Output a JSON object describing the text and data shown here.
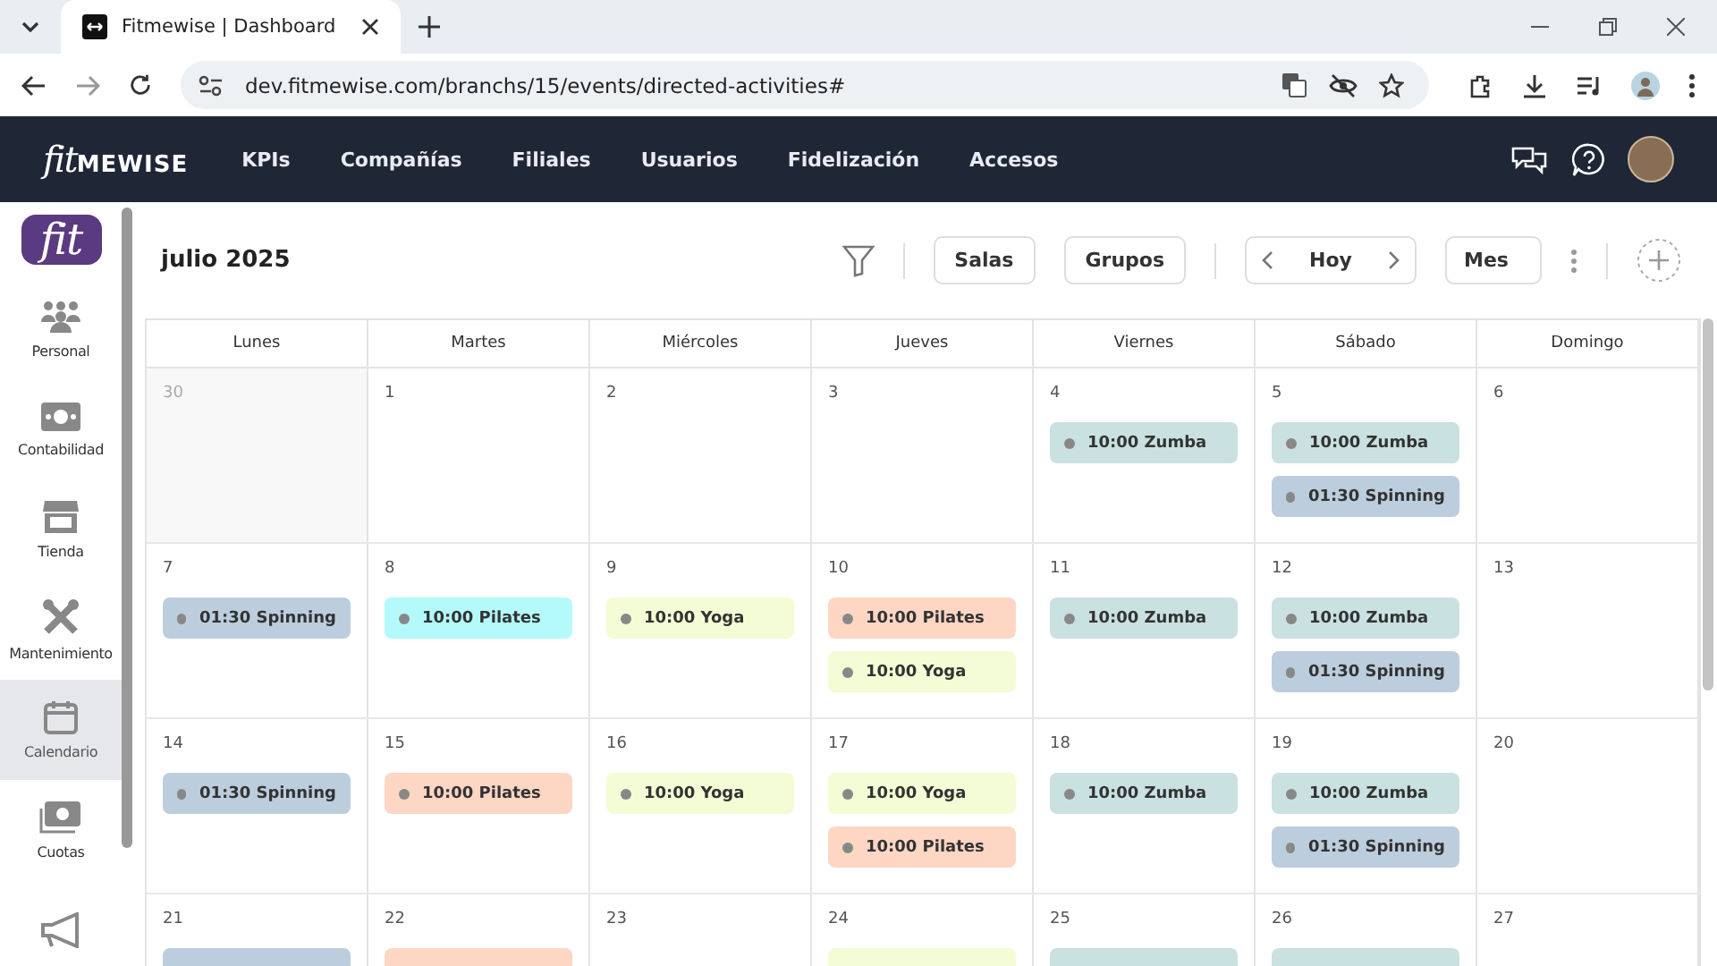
{
  "browser": {
    "tab_title": "Fitmewise | Dashboard",
    "url": "dev.fitmewise.com/branchs/15/events/directed-activities#"
  },
  "nav": {
    "logo": {
      "script": "fit",
      "text": "MEWISE"
    },
    "items": [
      {
        "label": "KPIs"
      },
      {
        "label": "Compañías"
      },
      {
        "label": "Filiales"
      },
      {
        "label": "Usuarios"
      },
      {
        "label": "Fidelización"
      },
      {
        "label": "Accesos"
      }
    ]
  },
  "sidebar": {
    "logo": "fit",
    "items": [
      {
        "label": "Personal",
        "selected": false
      },
      {
        "label": "Contabilidad",
        "selected": false
      },
      {
        "label": "Tienda",
        "selected": false
      },
      {
        "label": "Mantenimiento",
        "selected": false
      },
      {
        "label": "Calendario",
        "selected": true
      },
      {
        "label": "Cuotas",
        "selected": false
      },
      {
        "selected": false
      }
    ]
  },
  "toolbar": {
    "title": "julio 2025",
    "buttons": [
      "Salas",
      "Grupos"
    ],
    "today": "Hoy",
    "view": "Mes"
  },
  "calendar": {
    "weekdays": [
      "Lunes",
      "Martes",
      "Miércoles",
      "Jueves",
      "Viernes",
      "Sábado",
      "Domingo"
    ],
    "weeks": [
      [
        {
          "day": "30",
          "outside": true
        },
        {
          "day": "1",
          "outside": false
        },
        {
          "day": "2",
          "outside": false
        },
        {
          "day": "3",
          "outside": false
        },
        {
          "day": "4",
          "outside": false,
          "events": [
            {
              "label": "10:00 Zumba",
              "color": "#c9e1e0"
            }
          ]
        },
        {
          "day": "5",
          "outside": false,
          "events": [
            {
              "label": "10:00 Zumba",
              "color": "#c9e1e0"
            },
            {
              "label": "01:30 Spinning",
              "color": "#bccddd"
            }
          ]
        },
        {
          "day": "6",
          "outside": false
        }
      ],
      [
        {
          "day": "7",
          "outside": false,
          "events": [
            {
              "label": "01:30 Spinning",
              "color": "#bccddd"
            }
          ]
        },
        {
          "day": "8",
          "outside": false,
          "events": [
            {
              "label": "10:00 Pilates",
              "color": "#b4fafa"
            }
          ]
        },
        {
          "day": "9",
          "outside": false,
          "events": [
            {
              "label": "10:00 Yoga",
              "color": "#f3fcd5"
            }
          ]
        },
        {
          "day": "10",
          "outside": false,
          "events": [
            {
              "label": "10:00 Pilates",
              "color": "#fed6c4"
            },
            {
              "label": "10:00 Yoga",
              "color": "#f3fcd5"
            }
          ]
        },
        {
          "day": "11",
          "outside": false,
          "events": [
            {
              "label": "10:00 Zumba",
              "color": "#c9e1e0"
            }
          ]
        },
        {
          "day": "12",
          "outside": false,
          "events": [
            {
              "label": "10:00 Zumba",
              "color": "#c9e1e0"
            },
            {
              "label": "01:30 Spinning",
              "color": "#bccddd"
            }
          ]
        },
        {
          "day": "13",
          "outside": false
        }
      ],
      [
        {
          "day": "14",
          "outside": false,
          "events": [
            {
              "label": "01:30 Spinning",
              "color": "#bccddd"
            }
          ]
        },
        {
          "day": "15",
          "outside": false,
          "events": [
            {
              "label": "10:00 Pilates",
              "color": "#fed6c4"
            }
          ]
        },
        {
          "day": "16",
          "outside": false,
          "events": [
            {
              "label": "10:00 Yoga",
              "color": "#f3fcd5"
            }
          ]
        },
        {
          "day": "17",
          "outside": false,
          "events": [
            {
              "label": "10:00 Yoga",
              "color": "#f3fcd5"
            },
            {
              "label": "10:00 Pilates",
              "color": "#fed6c4"
            }
          ]
        },
        {
          "day": "18",
          "outside": false,
          "events": [
            {
              "label": "10:00 Zumba",
              "color": "#c9e1e0"
            }
          ]
        },
        {
          "day": "19",
          "outside": false,
          "events": [
            {
              "label": "10:00 Zumba",
              "color": "#c9e1e0"
            },
            {
              "label": "01:30 Spinning",
              "color": "#bccddd"
            }
          ]
        },
        {
          "day": "20",
          "outside": false
        }
      ],
      [
        {
          "day": "21",
          "outside": false,
          "events": [
            {
              "color": "#bccddd"
            }
          ]
        },
        {
          "day": "22",
          "outside": false,
          "events": [
            {
              "color": "#fed6c4"
            }
          ]
        },
        {
          "day": "23",
          "outside": false
        },
        {
          "day": "24",
          "outside": false,
          "events": [
            {
              "color": "#f3fcd5"
            }
          ]
        },
        {
          "day": "25",
          "outside": false,
          "events": [
            {
              "color": "#c9e1e0"
            }
          ]
        },
        {
          "day": "26",
          "outside": false,
          "events": [
            {
              "color": "#c9e1e0"
            }
          ]
        },
        {
          "day": "27",
          "outside": false
        }
      ]
    ]
  }
}
